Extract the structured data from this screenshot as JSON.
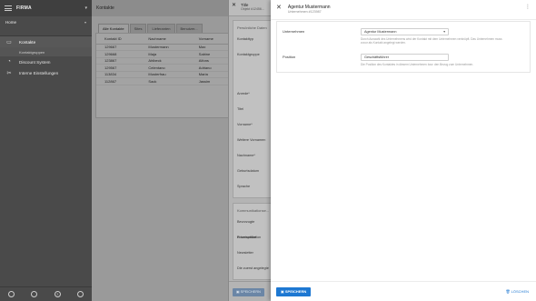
{
  "sidebar": {
    "brand": "FIRMA",
    "home": "Home",
    "items": [
      {
        "label": "Kontakte",
        "icon": "contacts-icon",
        "active": true
      },
      {
        "label": "Discount System",
        "icon": "discount-icon",
        "active": false
      },
      {
        "label": "Interne Einstellungen",
        "icon": "settings-icon",
        "active": false
      }
    ],
    "sub_item": "Kontaktgruppen"
  },
  "main": {
    "title": "Kontakte",
    "tabs": [
      "Alle Kontakte",
      "Sites",
      "Lieferanten",
      "Benutzer..."
    ],
    "table": {
      "headers": [
        "Kontakt ID",
        "Nachname",
        "Vorname"
      ],
      "rows": [
        [
          "129667",
          "Mustermann",
          "Max"
        ],
        [
          "129668",
          "Maja",
          "Sabine"
        ],
        [
          "123867",
          "Ahlbeck",
          "Alfons"
        ],
        [
          "129567",
          "Celentano",
          "Adriano"
        ],
        [
          "113834",
          "Musterfrau",
          "Maria"
        ],
        [
          "112867",
          "Sack",
          "Jassim"
        ]
      ]
    }
  },
  "middle": {
    "title": "Title",
    "subtitle": "Objekt #12456...",
    "section_title": "Persönliche Daten",
    "labels_top": [
      "Kontakttyp",
      "Kontaktgruppe"
    ],
    "labels_bottom": [
      "Anrede*",
      "Titel",
      "Vorname*",
      "Weitere Vornamen",
      "Nachname*",
      "Geburtsdatum",
      "Sprache"
    ],
    "section2": "Kommunikationse...",
    "labels_comm": [
      "Bevorzugte Kommunikation",
      "Privatsphäre",
      "Newsletter",
      "Die zuerst angelegte K..."
    ],
    "save_label": "SPEICHERN"
  },
  "panel": {
    "title": "Agentur Mustermann",
    "subtitle": "Unternehmen #123987",
    "company_label": "Unternehmen",
    "company_value": "Agentur Mustermann",
    "company_hint": "Durch Auswahl des Unternehmens wird der Kontakt mit dem Unternehmen verknüpft. Das Unternehmen muss zuvor als Kontakt angelegt werden.",
    "position_label": "Position",
    "position_value": "Geschäftsführer",
    "position_hint": "Die Position des Kontaktes in diesem Unternehmen bzw. den Bezug zum Unternehmen.",
    "save_label": "SPEICHERN",
    "delete_label": "LÖSCHEN"
  },
  "colors": {
    "accent": "#1e78d2",
    "sidebar": "#4a4a4a"
  }
}
